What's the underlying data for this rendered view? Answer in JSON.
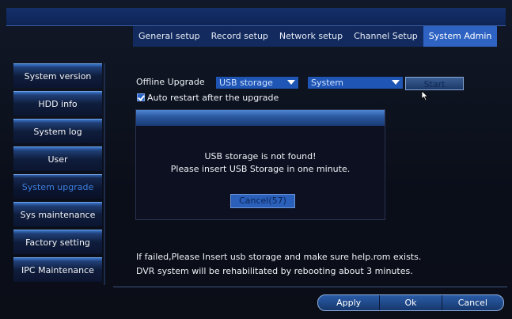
{
  "tabs": [
    "General setup",
    "Record setup",
    "Network setup",
    "Channel Setup",
    "System Admin"
  ],
  "active_tab": "System Admin",
  "sidebar": {
    "items": [
      "System version",
      "HDD info",
      "System log",
      "User",
      "System upgrade",
      "Sys maintenance",
      "Factory setting",
      "IPC Maintenance"
    ],
    "active": "System upgrade"
  },
  "upgrade": {
    "label": "Offline Upgrade",
    "source_select": "USB storage",
    "target_select": "System",
    "start_label": "Start",
    "auto_restart_label": "Auto restart after the upgrade",
    "auto_restart_checked": true
  },
  "dialog": {
    "line1": "USB storage is not found!",
    "line2": "Please insert USB Storage in one minute.",
    "cancel_label": "Cancel(57)"
  },
  "notes": {
    "line1": "If failed,Please Insert usb storage and make sure help.rom exists.",
    "line2": "DVR system will be rehabilitated by rebooting about 3 minutes."
  },
  "footer": {
    "apply_label": "Apply",
    "ok_label": "Ok",
    "cancel_label": "Cancel"
  },
  "colors": {
    "accent": "#2e63c3",
    "active_sidebar_text": "#3f7fe0"
  }
}
